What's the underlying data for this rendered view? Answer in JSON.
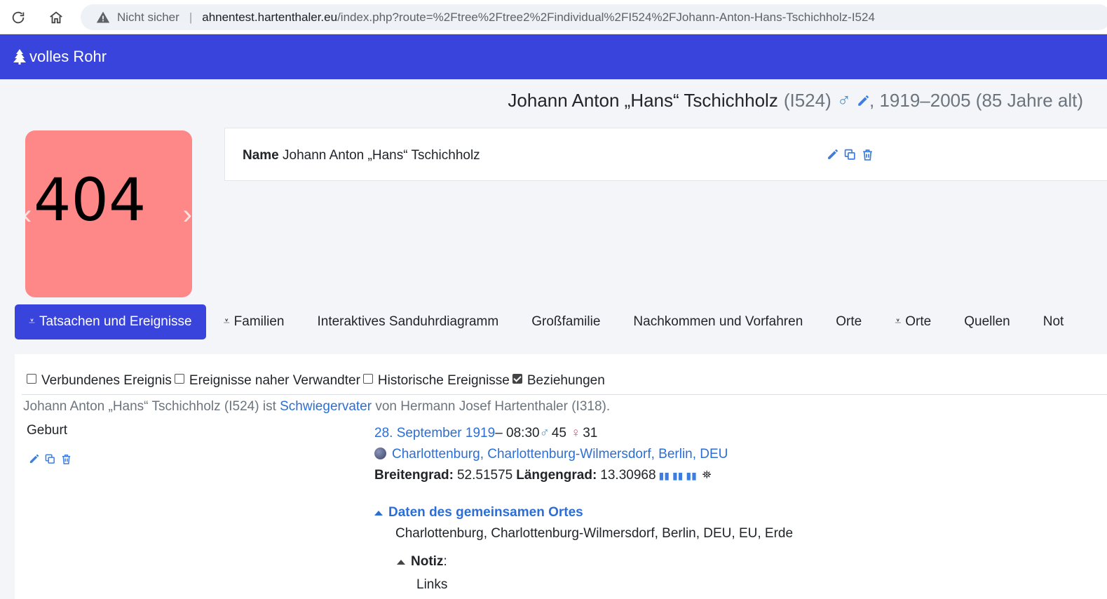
{
  "browser": {
    "not_secure": "Nicht sicher",
    "url_host": "ahnentest.hartenthaler.eu",
    "url_path": "/index.php?route=%2Ftree%2Ftree2%2Findividual%2FI524%2FJohann-Anton-Hans-Tschichholz-I524"
  },
  "header": {
    "brand": "volles Rohr"
  },
  "person": {
    "name": "Johann Anton „Hans“ Tschichholz",
    "id": "(I524)",
    "sex_symbol": "♂",
    "lifespan": ", 1919–2005 (85 Jahre alt)"
  },
  "photo": {
    "text": "404",
    "prev": "‹",
    "next": "›"
  },
  "name_card": {
    "label": "Name",
    "value": "Johann Anton „Hans“ Tschichholz"
  },
  "tabs": [
    {
      "label": "Tatsachen und Ereignisse",
      "icon": "⩡",
      "active": true
    },
    {
      "label": "Familien",
      "icon": "⩡"
    },
    {
      "label": "Interaktives Sanduhrdiagramm"
    },
    {
      "label": "Großfamilie"
    },
    {
      "label": "Nachkommen und Vorfahren"
    },
    {
      "label": "Orte"
    },
    {
      "label": "Orte",
      "icon": "⩡"
    },
    {
      "label": "Quellen"
    },
    {
      "label": "Not"
    }
  ],
  "filters": [
    {
      "label": "Verbundenes Ereignis",
      "checked": false
    },
    {
      "label": "Ereignisse naher Verwandter",
      "checked": false
    },
    {
      "label": "Historische Ereignisse",
      "checked": false
    },
    {
      "label": "Beziehungen",
      "checked": true
    }
  ],
  "relation": {
    "pre": "Johann Anton „Hans“ Tschichholz (I524) ist ",
    "link": "Schwiegervater",
    "post": " von Hermann Josef Hartenthaler (I318)."
  },
  "fact": {
    "label": "Geburt",
    "date": "28. September 1919",
    "time": " – 08:30 ",
    "father_age": "45",
    "mother_age": "31",
    "place": "Charlottenburg, Charlottenburg-Wilmersdorf, Berlin, DEU",
    "lat_label": "Breitengrad:",
    "lat": "52.51575",
    "lon_label": "Längengrad:",
    "lon": "13.30968",
    "shared_place_toggle": "Daten des gemeinsamen Ortes",
    "place_full": "Charlottenburg, Charlottenburg-Wilmersdorf, Berlin, DEU, EU, Erde",
    "note_label": "Notiz",
    "note_suffix": ":",
    "note_text": "Links"
  },
  "colors": {
    "brand": "#3844db",
    "photo_bg": "#fe8787",
    "link": "#2b6fd6"
  }
}
